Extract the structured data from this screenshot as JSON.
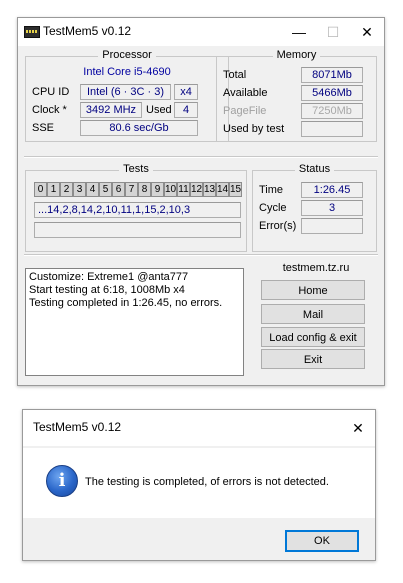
{
  "main_window": {
    "title": "TestMem5 v0.12",
    "controls": {
      "minimize": "—",
      "maximize": "☐",
      "close": "✕"
    },
    "processor": {
      "label": "Processor",
      "name": "Intel Core i5-4690",
      "cpu_id_label": "CPU ID",
      "cpu_id_value": "Intel (6 · 3C · 3)",
      "threads": "x4",
      "clock_label": "Clock *",
      "clock_value": "3492 MHz",
      "used_label": "Used",
      "used_value": "4",
      "sse_label": "SSE",
      "sse_value": "80.6 sec/Gb"
    },
    "memory": {
      "label": "Memory",
      "total_label": "Total",
      "total_value": "8071Mb",
      "available_label": "Available",
      "available_value": "5466Mb",
      "pagefile_label": "PageFile",
      "pagefile_value": "7250Mb",
      "used_by_test_label": "Used by test",
      "used_by_test_value": ""
    },
    "tests": {
      "label": "Tests",
      "numbers": [
        "0",
        "1",
        "2",
        "3",
        "4",
        "5",
        "6",
        "7",
        "8",
        "9",
        "10",
        "11",
        "12",
        "13",
        "14",
        "15"
      ],
      "sequence": "...14,2,8,14,2,10,11,1,15,2,10,3",
      "progress": ""
    },
    "status": {
      "label": "Status",
      "time_label": "Time",
      "time_value": "1:26.45",
      "cycle_label": "Cycle",
      "cycle_value": "3",
      "errors_label": "Error(s)",
      "errors_value": ""
    },
    "log": [
      "Customize: Extreme1 @anta777",
      "Start testing at 6:18, 1008Mb x4",
      "Testing completed in 1:26.45, no errors."
    ],
    "site": "testmem.tz.ru",
    "buttons": {
      "home": "Home",
      "mail": "Mail",
      "load_config": "Load config & exit",
      "exit": "Exit"
    }
  },
  "dialog": {
    "title": "TestMem5 v0.12",
    "close": "✕",
    "icon": "information-icon",
    "message": "The testing is completed, of errors is not detected.",
    "ok": "OK"
  },
  "colors": {
    "value_text": "#000080",
    "dialog_default_border": "#0078d7",
    "window_bg": "#f0f0f0"
  }
}
